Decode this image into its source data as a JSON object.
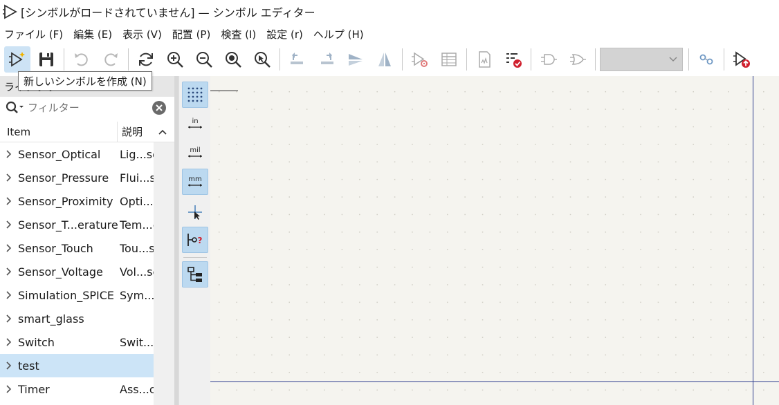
{
  "window": {
    "title": "[シンボルがロードされていません] — シンボル エディター"
  },
  "menubar": {
    "items": [
      "ファイル (F)",
      "編集 (E)",
      "表示 (V)",
      "配置 (P)",
      "検査 (I)",
      "設定 (r)",
      "ヘルプ (H)"
    ]
  },
  "toolbar": {
    "buttons": [
      "new-symbol-icon",
      "save-icon",
      "undo-icon",
      "redo-icon",
      "refresh-icon",
      "zoom-in-icon",
      "zoom-out-icon",
      "zoom-fit-icon",
      "zoom-selection-icon",
      "rotate-ccw-icon",
      "rotate-cw-icon",
      "mirror-vertical-icon",
      "mirror-horizontal-icon",
      "symbol-properties-icon",
      "pin-table-icon",
      "datasheet-icon",
      "symbol-checker-icon",
      "body-style-de-morgan-standard-icon",
      "body-style-de-morgan-alternate-icon",
      "unit-selector-combo",
      "pin-link-icon",
      "update-symbol-icon"
    ],
    "tooltip": "新しいシンボルを作成 (N)"
  },
  "library_panel": {
    "header": "ライブラリ",
    "filter_placeholder": "フィルター",
    "columns": {
      "item": "Item",
      "description": "説明"
    },
    "rows": [
      {
        "name": "Sensor_Optical",
        "desc": "Lig...sc"
      },
      {
        "name": "Sensor_Pressure",
        "desc": "Flui...s"
      },
      {
        "name": "Sensor_Proximity",
        "desc": "Opti...c"
      },
      {
        "name": "Sensor_T...erature",
        "desc": "Tem...c"
      },
      {
        "name": "Sensor_Touch",
        "desc": "Tou...s"
      },
      {
        "name": "Sensor_Voltage",
        "desc": "Vol...sc"
      },
      {
        "name": "Simulation_SPICE",
        "desc": "Sym...c"
      },
      {
        "name": "smart_glass",
        "desc": ""
      },
      {
        "name": "Switch",
        "desc": "Swit...c"
      },
      {
        "name": "test",
        "desc": "",
        "selected": true
      },
      {
        "name": "Timer",
        "desc": "Ass...c"
      }
    ]
  },
  "left_toolbar": {
    "buttons": [
      {
        "icon": "grid-icon",
        "label": "",
        "active": true
      },
      {
        "icon": "units-inch-icon",
        "label": "in",
        "active": false
      },
      {
        "icon": "units-mil-icon",
        "label": "mil",
        "active": false
      },
      {
        "icon": "units-mm-icon",
        "label": "mm",
        "active": true
      },
      {
        "icon": "cursor-crosshair-icon",
        "label": "",
        "active": false
      },
      {
        "icon": "pin-type-question-icon",
        "label": "",
        "active": true
      },
      {
        "icon": "hierarchy-tree-icon",
        "label": "",
        "active": true
      }
    ]
  },
  "colors": {
    "selection": "#cce4f7",
    "active_tool": "#bcd9f0",
    "canvas_bg": "#f5f4ef",
    "sheet_border": "#2b3a8c",
    "accent_red": "#d0202e",
    "accent_blue": "#2b6cb0"
  }
}
